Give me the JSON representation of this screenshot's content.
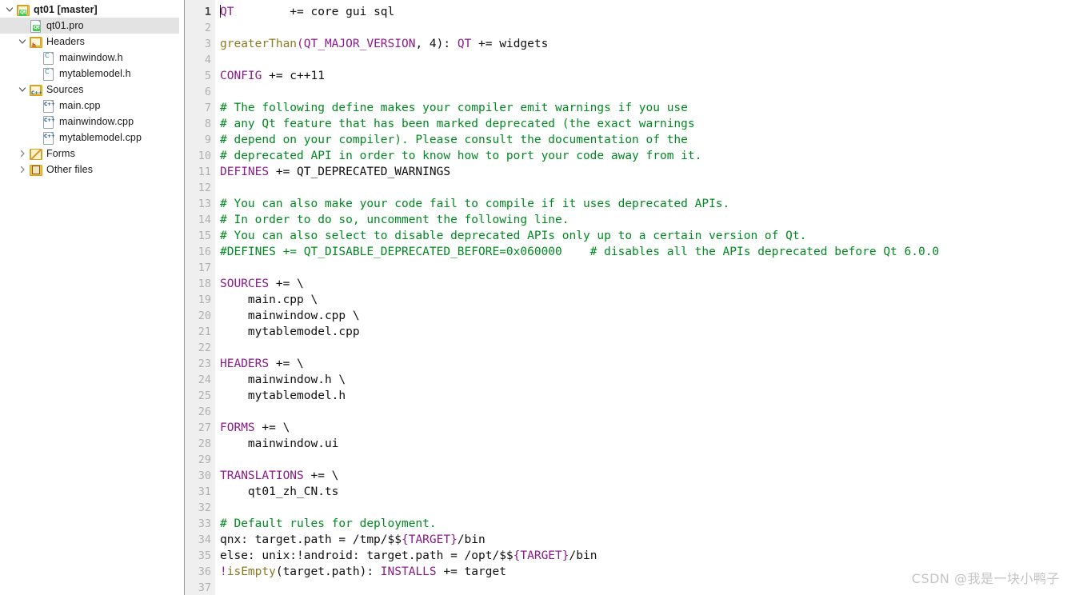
{
  "sidebar": {
    "items": [
      {
        "label": "qt01 [master]",
        "icon": "qt-project-icon",
        "indent": 0,
        "twisty": "down",
        "bold": true,
        "selected": false,
        "kind": "qtproject"
      },
      {
        "label": "qt01.pro",
        "icon": "qt-pro-file-icon",
        "indent": 1,
        "twisty": "none",
        "bold": false,
        "selected": true,
        "kind": "qtpro"
      },
      {
        "label": "Headers",
        "icon": "headers-folder-icon",
        "indent": 1,
        "twisty": "down",
        "bold": false,
        "selected": false,
        "kind": "folder-h"
      },
      {
        "label": "mainwindow.h",
        "icon": "c-header-file-icon",
        "indent": 2,
        "twisty": "none",
        "bold": false,
        "selected": false,
        "kind": "hfile"
      },
      {
        "label": "mytablemodel.h",
        "icon": "c-header-file-icon",
        "indent": 2,
        "twisty": "none",
        "bold": false,
        "selected": false,
        "kind": "hfile"
      },
      {
        "label": "Sources",
        "icon": "sources-folder-icon",
        "indent": 1,
        "twisty": "down",
        "bold": false,
        "selected": false,
        "kind": "folder-cpp"
      },
      {
        "label": "main.cpp",
        "icon": "cpp-source-file-icon",
        "indent": 2,
        "twisty": "none",
        "bold": false,
        "selected": false,
        "kind": "cppfile"
      },
      {
        "label": "mainwindow.cpp",
        "icon": "cpp-source-file-icon",
        "indent": 2,
        "twisty": "none",
        "bold": false,
        "selected": false,
        "kind": "cppfile"
      },
      {
        "label": "mytablemodel.cpp",
        "icon": "cpp-source-file-icon",
        "indent": 2,
        "twisty": "none",
        "bold": false,
        "selected": false,
        "kind": "cppfile"
      },
      {
        "label": "Forms",
        "icon": "forms-folder-icon",
        "indent": 1,
        "twisty": "right",
        "bold": false,
        "selected": false,
        "kind": "folder-forms"
      },
      {
        "label": "Other files",
        "icon": "other-files-folder-icon",
        "indent": 1,
        "twisty": "right",
        "bold": false,
        "selected": false,
        "kind": "folder-other"
      }
    ]
  },
  "editor": {
    "current_line": 1,
    "colors": {
      "variable": "#8b1a8b",
      "comment": "#008a20",
      "function": "#8a7b20",
      "text": "#101010",
      "gutter_bg": "#efefef",
      "gutter_number": "#b0b0b0"
    },
    "lines": [
      {
        "n": 1,
        "tokens": [
          {
            "t": "QT",
            "c": "k"
          },
          {
            "t": "        += core gui sql",
            "c": "tx"
          }
        ],
        "caret_at": 0
      },
      {
        "n": 2,
        "tokens": []
      },
      {
        "n": 3,
        "tokens": [
          {
            "t": "greaterThan",
            "c": "fn"
          },
          {
            "t": "(",
            "c": "pn"
          },
          {
            "t": "QT_MAJOR_VERSION",
            "c": "k"
          },
          {
            "t": ", 4)",
            "c": "tx"
          },
          {
            "t": ":",
            "c": "tx"
          },
          {
            "t": " ",
            "c": "tx"
          },
          {
            "t": "QT",
            "c": "k"
          },
          {
            "t": " += widgets",
            "c": "tx"
          }
        ]
      },
      {
        "n": 4,
        "tokens": []
      },
      {
        "n": 5,
        "tokens": [
          {
            "t": "CONFIG",
            "c": "k"
          },
          {
            "t": " += c++11",
            "c": "tx"
          }
        ]
      },
      {
        "n": 6,
        "tokens": []
      },
      {
        "n": 7,
        "tokens": [
          {
            "t": "# The following define makes your compiler emit warnings if you use",
            "c": "cm"
          }
        ]
      },
      {
        "n": 8,
        "tokens": [
          {
            "t": "# any Qt feature that has been marked deprecated (the exact warnings",
            "c": "cm"
          }
        ]
      },
      {
        "n": 9,
        "tokens": [
          {
            "t": "# depend on your compiler). Please consult the documentation of the",
            "c": "cm"
          }
        ]
      },
      {
        "n": 10,
        "tokens": [
          {
            "t": "# deprecated API in order to know how to port your code away from it.",
            "c": "cm"
          }
        ]
      },
      {
        "n": 11,
        "tokens": [
          {
            "t": "DEFINES",
            "c": "k"
          },
          {
            "t": " += QT_DEPRECATED_WARNINGS",
            "c": "tx"
          }
        ]
      },
      {
        "n": 12,
        "tokens": []
      },
      {
        "n": 13,
        "tokens": [
          {
            "t": "# You can also make your code fail to compile if it uses deprecated APIs.",
            "c": "cm"
          }
        ]
      },
      {
        "n": 14,
        "tokens": [
          {
            "t": "# In order to do so, uncomment the following line.",
            "c": "cm"
          }
        ]
      },
      {
        "n": 15,
        "tokens": [
          {
            "t": "# You can also select to disable deprecated APIs only up to a certain version of Qt.",
            "c": "cm"
          }
        ]
      },
      {
        "n": 16,
        "tokens": [
          {
            "t": "#DEFINES += QT_DISABLE_DEPRECATED_BEFORE=0x060000    # disables all the APIs deprecated before Qt 6.0.0",
            "c": "cm"
          }
        ]
      },
      {
        "n": 17,
        "tokens": []
      },
      {
        "n": 18,
        "tokens": [
          {
            "t": "SOURCES",
            "c": "k"
          },
          {
            "t": " += \\",
            "c": "tx"
          }
        ]
      },
      {
        "n": 19,
        "tokens": [
          {
            "t": "    main.cpp \\",
            "c": "tx"
          }
        ]
      },
      {
        "n": 20,
        "tokens": [
          {
            "t": "    mainwindow.cpp \\",
            "c": "tx"
          }
        ]
      },
      {
        "n": 21,
        "tokens": [
          {
            "t": "    mytablemodel.cpp",
            "c": "tx"
          }
        ]
      },
      {
        "n": 22,
        "tokens": []
      },
      {
        "n": 23,
        "tokens": [
          {
            "t": "HEADERS",
            "c": "k"
          },
          {
            "t": " += \\",
            "c": "tx"
          }
        ]
      },
      {
        "n": 24,
        "tokens": [
          {
            "t": "    mainwindow.h \\",
            "c": "tx"
          }
        ]
      },
      {
        "n": 25,
        "tokens": [
          {
            "t": "    mytablemodel.h",
            "c": "tx"
          }
        ]
      },
      {
        "n": 26,
        "tokens": []
      },
      {
        "n": 27,
        "tokens": [
          {
            "t": "FORMS",
            "c": "k"
          },
          {
            "t": " += \\",
            "c": "tx"
          }
        ]
      },
      {
        "n": 28,
        "tokens": [
          {
            "t": "    mainwindow.ui",
            "c": "tx"
          }
        ]
      },
      {
        "n": 29,
        "tokens": []
      },
      {
        "n": 30,
        "tokens": [
          {
            "t": "TRANSLATIONS",
            "c": "k"
          },
          {
            "t": " += \\",
            "c": "tx"
          }
        ]
      },
      {
        "n": 31,
        "tokens": [
          {
            "t": "    qt01_zh_CN.ts",
            "c": "tx"
          }
        ]
      },
      {
        "n": 32,
        "tokens": []
      },
      {
        "n": 33,
        "tokens": [
          {
            "t": "# Default rules for deployment.",
            "c": "cm"
          }
        ]
      },
      {
        "n": 34,
        "tokens": [
          {
            "t": "qnx: target.path = /tmp/$$",
            "c": "tx"
          },
          {
            "t": "{TARGET}",
            "c": "k"
          },
          {
            "t": "/bin",
            "c": "tx"
          }
        ]
      },
      {
        "n": 35,
        "tokens": [
          {
            "t": "else: unix:!android: target.path = /opt/$$",
            "c": "tx"
          },
          {
            "t": "{TARGET}",
            "c": "k"
          },
          {
            "t": "/bin",
            "c": "tx"
          }
        ]
      },
      {
        "n": 36,
        "tokens": [
          {
            "t": "!",
            "c": "pn"
          },
          {
            "t": "isEmpty",
            "c": "fn"
          },
          {
            "t": "(target.path): ",
            "c": "tx"
          },
          {
            "t": "INSTALLS",
            "c": "k"
          },
          {
            "t": " += target",
            "c": "tx"
          }
        ]
      },
      {
        "n": 37,
        "tokens": []
      }
    ]
  },
  "watermark": {
    "text": "CSDN @我是一块小鸭子"
  }
}
